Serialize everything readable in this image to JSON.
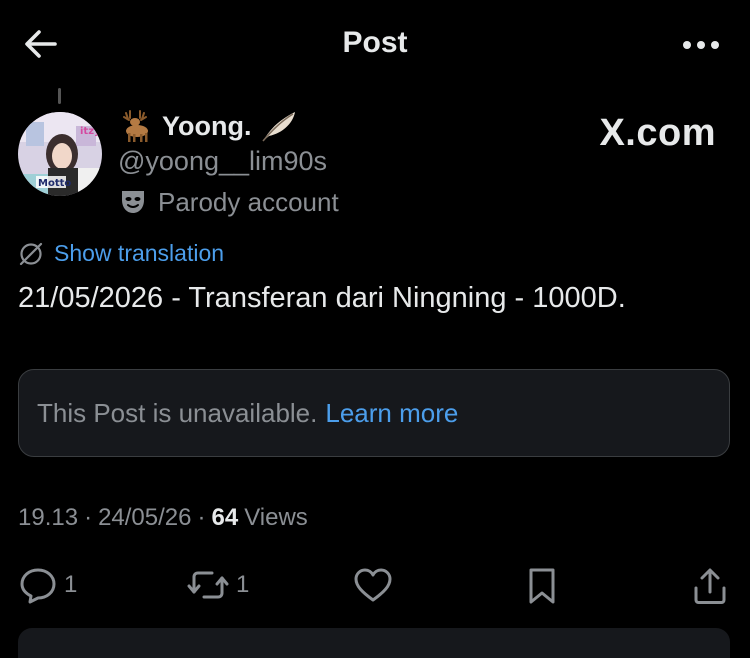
{
  "header": {
    "title": "Post"
  },
  "user": {
    "display_name": "Yoong.",
    "handle": "@yoong__lim90s",
    "label": "Parody account",
    "avatar_text_top": "itzy",
    "avatar_text_bottom": "Motto"
  },
  "watermark": "X.com",
  "translation": {
    "label": "Show translation"
  },
  "post": {
    "text": "21/05/2026 - Transferan dari Ningning - 1000D.",
    "quoted": {
      "message": "This Post is unavailable.",
      "link": "Learn more"
    }
  },
  "meta": {
    "time": "19.13",
    "separator": "·",
    "date": "24/05/26",
    "views_count": "64",
    "views_label": "Views"
  },
  "actions": {
    "replies": "1",
    "reposts": "1"
  },
  "colors": {
    "background": "#000000",
    "text": "#e7e9ea",
    "secondary": "#8b8f94",
    "link": "#4c9eeb",
    "card": "#16181c"
  },
  "icons": {
    "back": "arrow-left-icon",
    "more": "more-horizontal-icon",
    "name_emoji_1": "deer-icon",
    "name_emoji_2": "feather-icon",
    "parody": "theater-mask-icon",
    "translate": "translate-icon",
    "reply": "reply-icon",
    "repost": "repost-icon",
    "like": "heart-icon",
    "bookmark": "bookmark-icon",
    "share": "share-icon"
  }
}
